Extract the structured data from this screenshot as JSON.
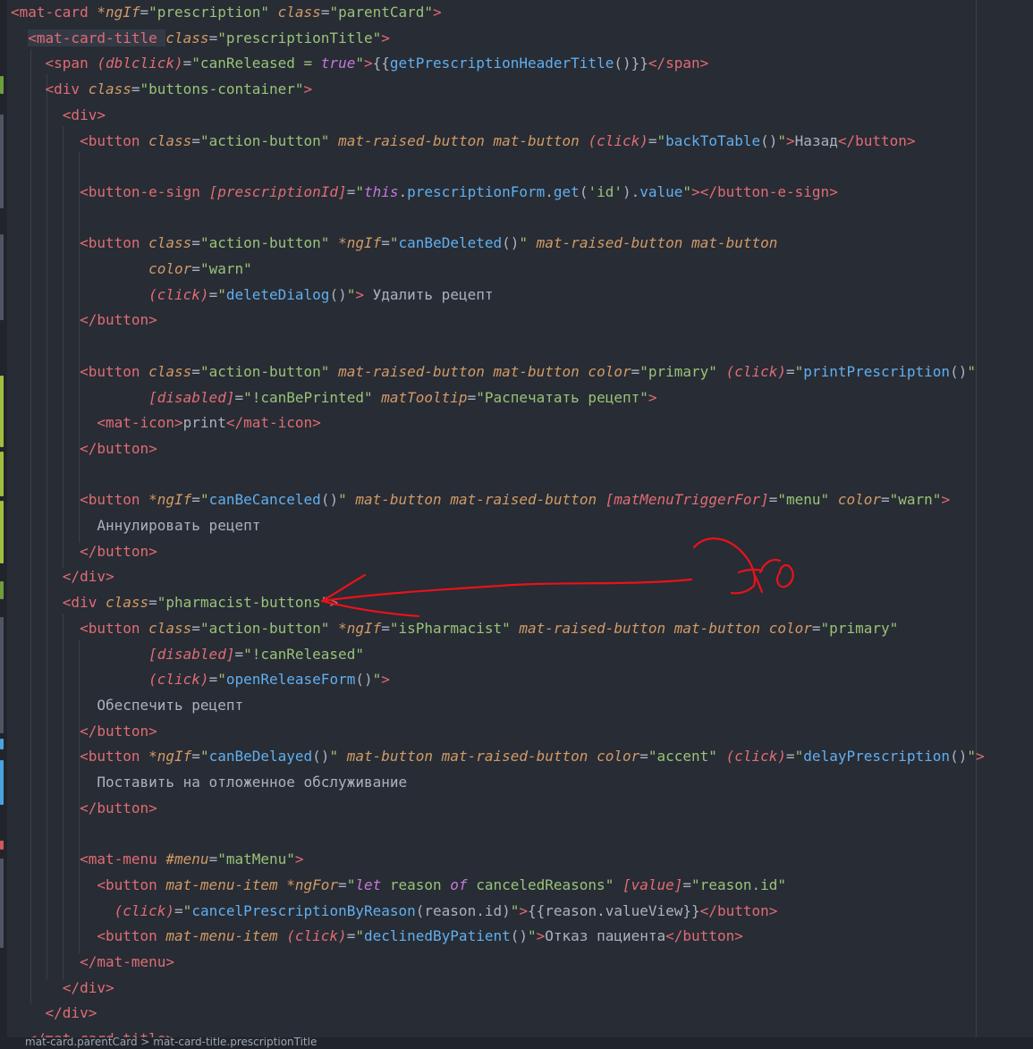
{
  "code_lines": [
    [
      [
        "t",
        "<mat-card "
      ],
      [
        "a",
        "*ngIf"
      ],
      [
        "p",
        "="
      ],
      [
        "s",
        "\"prescription\""
      ],
      [
        "p",
        " "
      ],
      [
        "a",
        "class"
      ],
      [
        "p",
        "="
      ],
      [
        "s",
        "\"parentCard\""
      ],
      [
        "t",
        ">"
      ]
    ],
    [
      [
        "p",
        "  "
      ],
      [
        "t",
        "<mat-card-title "
      ],
      [
        "a",
        "class"
      ],
      [
        "p",
        "="
      ],
      [
        "s",
        "\"prescriptionTitle\""
      ],
      [
        "t",
        ">"
      ]
    ],
    [
      [
        "p",
        "    "
      ],
      [
        "t",
        "<span "
      ],
      [
        "ab",
        "(dblclick)"
      ],
      [
        "p",
        "="
      ],
      [
        "s",
        "\"canReleased = "
      ],
      [
        "k",
        "true"
      ],
      [
        "s",
        "\""
      ],
      [
        "t",
        ">"
      ],
      [
        "p",
        "{{"
      ],
      [
        "f",
        "getPrescriptionHeaderTitle"
      ],
      [
        "p",
        "()}}"
      ],
      [
        "t",
        "</span>"
      ]
    ],
    [
      [
        "p",
        "    "
      ],
      [
        "t",
        "<div "
      ],
      [
        "a",
        "class"
      ],
      [
        "p",
        "="
      ],
      [
        "s",
        "\"buttons-container\""
      ],
      [
        "t",
        ">"
      ]
    ],
    [
      [
        "p",
        "      "
      ],
      [
        "t",
        "<div>"
      ]
    ],
    [
      [
        "p",
        "        "
      ],
      [
        "t",
        "<button "
      ],
      [
        "a",
        "class"
      ],
      [
        "p",
        "="
      ],
      [
        "s",
        "\"action-button\""
      ],
      [
        "p",
        " "
      ],
      [
        "a",
        "mat-raised-button mat-button "
      ],
      [
        "ab",
        "(click)"
      ],
      [
        "p",
        "="
      ],
      [
        "s",
        "\""
      ],
      [
        "f",
        "backToTable"
      ],
      [
        "p",
        "()"
      ],
      [
        "s",
        "\""
      ],
      [
        "t",
        ">"
      ],
      [
        "p",
        "Назад"
      ],
      [
        "t",
        "</button>"
      ]
    ],
    [],
    [
      [
        "p",
        "        "
      ],
      [
        "t",
        "<button-e-sign "
      ],
      [
        "ab",
        "[prescriptionId]"
      ],
      [
        "p",
        "="
      ],
      [
        "s",
        "\""
      ],
      [
        "k",
        "this"
      ],
      [
        "p",
        "."
      ],
      [
        "f",
        "prescriptionForm"
      ],
      [
        "p",
        "."
      ],
      [
        "f",
        "get"
      ],
      [
        "p",
        "("
      ],
      [
        "s",
        "'id'"
      ],
      [
        "p",
        ")."
      ],
      [
        "f",
        "value"
      ],
      [
        "s",
        "\""
      ],
      [
        "t",
        "></button-e-sign>"
      ]
    ],
    [],
    [
      [
        "p",
        "        "
      ],
      [
        "t",
        "<button "
      ],
      [
        "a",
        "class"
      ],
      [
        "p",
        "="
      ],
      [
        "s",
        "\"action-button\""
      ],
      [
        "p",
        " "
      ],
      [
        "a",
        "*ngIf"
      ],
      [
        "p",
        "="
      ],
      [
        "s",
        "\""
      ],
      [
        "f",
        "canBeDeleted"
      ],
      [
        "p",
        "()"
      ],
      [
        "s",
        "\""
      ],
      [
        "p",
        " "
      ],
      [
        "a",
        "mat-raised-button mat-button"
      ]
    ],
    [
      [
        "p",
        "                "
      ],
      [
        "a",
        "color"
      ],
      [
        "p",
        "="
      ],
      [
        "s",
        "\"warn\""
      ]
    ],
    [
      [
        "p",
        "                "
      ],
      [
        "ab",
        "(click)"
      ],
      [
        "p",
        "="
      ],
      [
        "s",
        "\""
      ],
      [
        "f",
        "deleteDialog"
      ],
      [
        "p",
        "()"
      ],
      [
        "s",
        "\""
      ],
      [
        "t",
        ">"
      ],
      [
        "p",
        " Удалить рецепт"
      ]
    ],
    [
      [
        "p",
        "        "
      ],
      [
        "t",
        "</button>"
      ]
    ],
    [],
    [
      [
        "p",
        "        "
      ],
      [
        "t",
        "<button "
      ],
      [
        "a",
        "class"
      ],
      [
        "p",
        "="
      ],
      [
        "s",
        "\"action-button\""
      ],
      [
        "p",
        " "
      ],
      [
        "a",
        "mat-raised-button mat-button color"
      ],
      [
        "p",
        "="
      ],
      [
        "s",
        "\"primary\""
      ],
      [
        "p",
        " "
      ],
      [
        "ab",
        "(click)"
      ],
      [
        "p",
        "="
      ],
      [
        "s",
        "\""
      ],
      [
        "f",
        "printPrescription"
      ],
      [
        "p",
        "()"
      ],
      [
        "s",
        "\""
      ]
    ],
    [
      [
        "p",
        "                "
      ],
      [
        "ab",
        "[disabled]"
      ],
      [
        "p",
        "="
      ],
      [
        "s",
        "\"!canBePrinted\""
      ],
      [
        "p",
        " "
      ],
      [
        "a",
        "matTooltip"
      ],
      [
        "p",
        "="
      ],
      [
        "s",
        "\"Распечатать рецепт\""
      ],
      [
        "t",
        ">"
      ]
    ],
    [
      [
        "p",
        "          "
      ],
      [
        "t",
        "<mat-icon>"
      ],
      [
        "p",
        "print"
      ],
      [
        "t",
        "</mat-icon>"
      ]
    ],
    [
      [
        "p",
        "        "
      ],
      [
        "t",
        "</button>"
      ]
    ],
    [],
    [
      [
        "p",
        "        "
      ],
      [
        "t",
        "<button "
      ],
      [
        "a",
        "*ngIf"
      ],
      [
        "p",
        "="
      ],
      [
        "s",
        "\""
      ],
      [
        "f",
        "canBeCanceled"
      ],
      [
        "p",
        "()"
      ],
      [
        "s",
        "\""
      ],
      [
        "p",
        " "
      ],
      [
        "a",
        "mat-button mat-raised-button "
      ],
      [
        "ab",
        "[matMenuTriggerFor]"
      ],
      [
        "p",
        "="
      ],
      [
        "s",
        "\"menu\""
      ],
      [
        "p",
        " "
      ],
      [
        "a",
        "color"
      ],
      [
        "p",
        "="
      ],
      [
        "s",
        "\"warn\""
      ],
      [
        "t",
        ">"
      ]
    ],
    [
      [
        "p",
        "          Аннулировать рецепт"
      ]
    ],
    [
      [
        "p",
        "        "
      ],
      [
        "t",
        "</button>"
      ]
    ],
    [
      [
        "p",
        "      "
      ],
      [
        "t",
        "</div>"
      ]
    ],
    [
      [
        "p",
        "      "
      ],
      [
        "t",
        "<div "
      ],
      [
        "a",
        "class"
      ],
      [
        "p",
        "="
      ],
      [
        "s",
        "\"pharmacist-buttons\""
      ],
      [
        "t",
        ">"
      ]
    ],
    [
      [
        "p",
        "        "
      ],
      [
        "t",
        "<button "
      ],
      [
        "a",
        "class"
      ],
      [
        "p",
        "="
      ],
      [
        "s",
        "\"action-button\""
      ],
      [
        "p",
        " "
      ],
      [
        "a",
        "*ngIf"
      ],
      [
        "p",
        "="
      ],
      [
        "s",
        "\"isPharmacist\""
      ],
      [
        "p",
        " "
      ],
      [
        "a",
        "mat-raised-button mat-button color"
      ],
      [
        "p",
        "="
      ],
      [
        "s",
        "\"primary\""
      ]
    ],
    [
      [
        "p",
        "                "
      ],
      [
        "ab",
        "[disabled]"
      ],
      [
        "p",
        "="
      ],
      [
        "s",
        "\"!canReleased\""
      ]
    ],
    [
      [
        "p",
        "                "
      ],
      [
        "ab",
        "(click)"
      ],
      [
        "p",
        "="
      ],
      [
        "s",
        "\""
      ],
      [
        "f",
        "openReleaseForm"
      ],
      [
        "p",
        "()"
      ],
      [
        "s",
        "\""
      ],
      [
        "t",
        ">"
      ]
    ],
    [
      [
        "p",
        "          Обеспечить рецепт"
      ]
    ],
    [
      [
        "p",
        "        "
      ],
      [
        "t",
        "</button>"
      ]
    ],
    [
      [
        "p",
        "        "
      ],
      [
        "t",
        "<button "
      ],
      [
        "a",
        "*ngIf"
      ],
      [
        "p",
        "="
      ],
      [
        "s",
        "\""
      ],
      [
        "f",
        "canBeDelayed"
      ],
      [
        "p",
        "()"
      ],
      [
        "s",
        "\""
      ],
      [
        "p",
        " "
      ],
      [
        "a",
        "mat-button mat-raised-button color"
      ],
      [
        "p",
        "="
      ],
      [
        "s",
        "\"accent\""
      ],
      [
        "p",
        " "
      ],
      [
        "ab",
        "(click)"
      ],
      [
        "p",
        "="
      ],
      [
        "s",
        "\""
      ],
      [
        "f",
        "delayPrescription"
      ],
      [
        "p",
        "()"
      ],
      [
        "s",
        "\""
      ],
      [
        "t",
        ">"
      ]
    ],
    [
      [
        "p",
        "          Поставить на отложенное обслуживание"
      ]
    ],
    [
      [
        "p",
        "        "
      ],
      [
        "t",
        "</button>"
      ]
    ],
    [],
    [
      [
        "p",
        "        "
      ],
      [
        "t",
        "<mat-menu "
      ],
      [
        "a",
        "#menu"
      ],
      [
        "p",
        "="
      ],
      [
        "s",
        "\"matMenu\""
      ],
      [
        "t",
        ">"
      ]
    ],
    [
      [
        "p",
        "          "
      ],
      [
        "t",
        "<button "
      ],
      [
        "a",
        "mat-menu-item "
      ],
      [
        "a",
        "*ngFor"
      ],
      [
        "p",
        "="
      ],
      [
        "s",
        "\""
      ],
      [
        "k",
        "let"
      ],
      [
        "s",
        " reason "
      ],
      [
        "k",
        "of"
      ],
      [
        "s",
        " canceledReasons\""
      ],
      [
        "p",
        " "
      ],
      [
        "ab",
        "[value]"
      ],
      [
        "p",
        "="
      ],
      [
        "s",
        "\"reason.id\""
      ]
    ],
    [
      [
        "p",
        "            "
      ],
      [
        "ab",
        "(click)"
      ],
      [
        "p",
        "="
      ],
      [
        "s",
        "\""
      ],
      [
        "f",
        "cancelPrescriptionByReason"
      ],
      [
        "p",
        "(reason.id)"
      ],
      [
        "s",
        "\""
      ],
      [
        "t",
        ">"
      ],
      [
        "p",
        "{{reason.valueView}}"
      ],
      [
        "t",
        "</button>"
      ]
    ],
    [
      [
        "p",
        "          "
      ],
      [
        "t",
        "<button "
      ],
      [
        "a",
        "mat-menu-item "
      ],
      [
        "ab",
        "(click)"
      ],
      [
        "p",
        "="
      ],
      [
        "s",
        "\""
      ],
      [
        "f",
        "declinedByPatient"
      ],
      [
        "p",
        "()"
      ],
      [
        "s",
        "\""
      ],
      [
        "t",
        ">"
      ],
      [
        "p",
        "Отказ пациента"
      ],
      [
        "t",
        "</button>"
      ]
    ],
    [
      [
        "p",
        "        "
      ],
      [
        "t",
        "</mat-menu>"
      ]
    ],
    [
      [
        "p",
        "      "
      ],
      [
        "t",
        "</div>"
      ]
    ],
    [
      [
        "p",
        "    "
      ],
      [
        "t",
        "</div>"
      ]
    ],
    [
      [
        "p",
        "  "
      ],
      [
        "t",
        "</mat-card-title>"
      ]
    ]
  ],
  "colors": {
    "background": "#282c34",
    "tag": "#e06c75",
    "attribute": "#d19a66",
    "string": "#98c379",
    "keyword": "#c678dd",
    "function": "#61afef",
    "plain": "#abb2bf",
    "annotation": "#e8121b"
  },
  "annotation_text": "Это",
  "breadcrumb": "mat-card.parentCard > mat-card-title.prescriptionTitle"
}
